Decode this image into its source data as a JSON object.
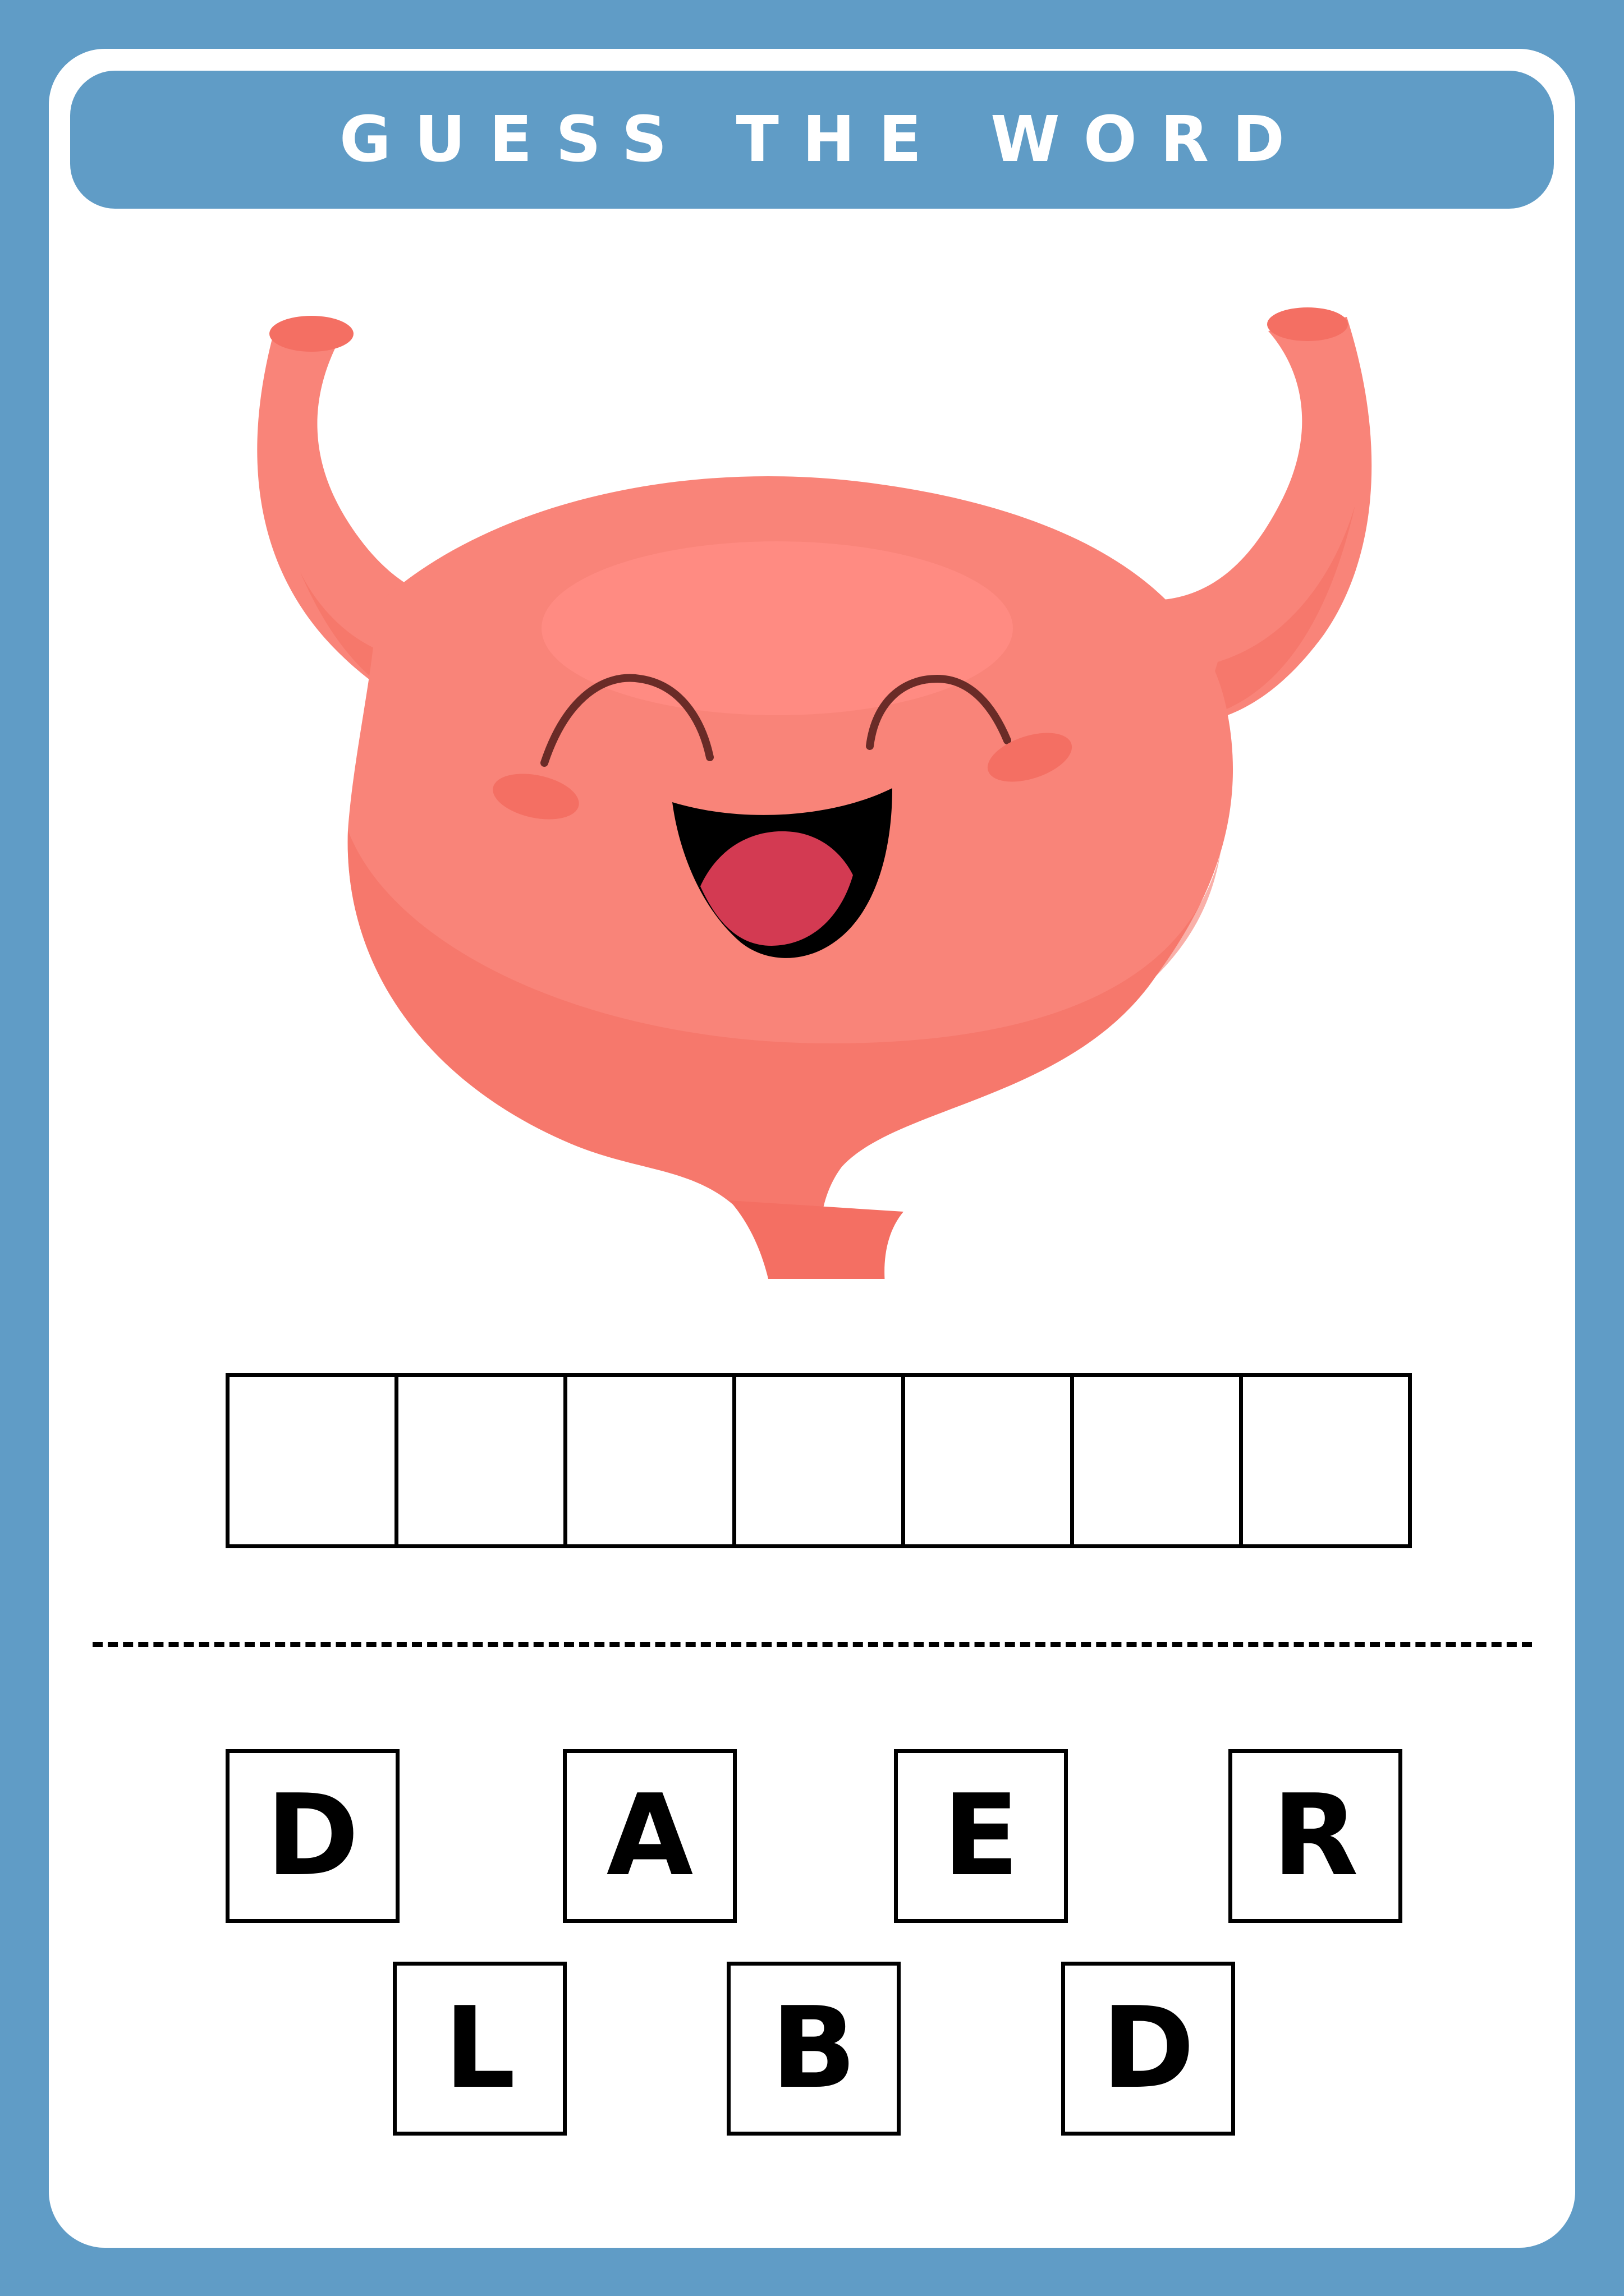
{
  "title": "GUESS THE WORD",
  "mascot": {
    "icon": "bladder-mascot-icon"
  },
  "answer": {
    "slots": 7
  },
  "letters": [
    "D",
    "A",
    "E",
    "R",
    "L",
    "B",
    "D"
  ],
  "colors": {
    "background": "#609cc6",
    "card": "#ffffff",
    "organ": "#f98479",
    "organ_shadow": "#f46f63",
    "tongue": "#d33a52",
    "eye": "#6a2b27"
  }
}
